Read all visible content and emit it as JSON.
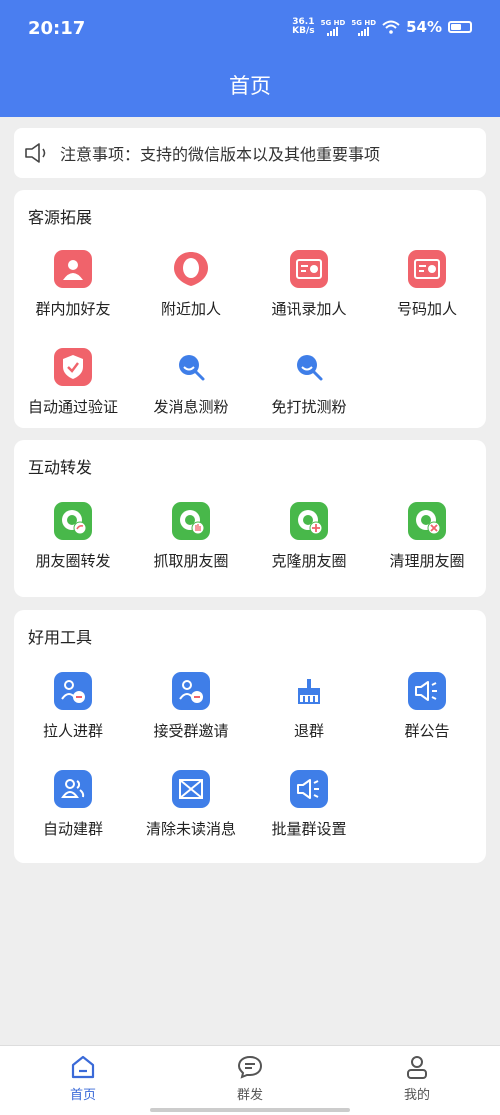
{
  "status_bar": {
    "time": "20:17",
    "net_speed_top": "36.1",
    "net_speed_unit": "KB/s",
    "sim1_label": "5G HD",
    "sim2_label": "5G HD",
    "battery": "54%"
  },
  "header": {
    "title": "首页"
  },
  "notice": {
    "icon": "speaker-icon",
    "text": "注意事项：支持的微信版本以及其他重要事项"
  },
  "sections": [
    {
      "title": "客源拓展",
      "items": [
        {
          "label": "群内加好友",
          "icon": "group-add-friend-icon"
        },
        {
          "label": "附近加人",
          "icon": "location-pin-icon"
        },
        {
          "label": "通讯录加人",
          "icon": "contacts-card-icon"
        },
        {
          "label": "号码加人",
          "icon": "number-card-icon"
        },
        {
          "label": "自动通过验证",
          "icon": "shield-check-icon"
        },
        {
          "label": "发消息测粉",
          "icon": "search-icon"
        },
        {
          "label": "免打扰测粉",
          "icon": "search-icon"
        }
      ]
    },
    {
      "title": "互动转发",
      "items": [
        {
          "label": "朋友圈转发",
          "icon": "moments-share-icon"
        },
        {
          "label": "抓取朋友圈",
          "icon": "moments-grab-icon"
        },
        {
          "label": "克隆朋友圈",
          "icon": "moments-clone-icon"
        },
        {
          "label": "清理朋友圈",
          "icon": "moments-clean-icon"
        }
      ]
    },
    {
      "title": "好用工具",
      "items": [
        {
          "label": "拉人进群",
          "icon": "pull-into-group-icon"
        },
        {
          "label": "接受群邀请",
          "icon": "accept-invite-icon"
        },
        {
          "label": "退群",
          "icon": "broom-icon"
        },
        {
          "label": "群公告",
          "icon": "announcement-icon"
        },
        {
          "label": "自动建群",
          "icon": "create-group-icon"
        },
        {
          "label": "清除未读消息",
          "icon": "envelope-clear-icon"
        },
        {
          "label": "批量群设置",
          "icon": "batch-settings-icon"
        }
      ]
    }
  ],
  "tabbar": {
    "items": [
      {
        "label": "首页",
        "icon": "home-icon",
        "active": true
      },
      {
        "label": "群发",
        "icon": "chat-bubble-icon",
        "active": false
      },
      {
        "label": "我的",
        "icon": "user-icon",
        "active": false
      }
    ]
  },
  "colors": {
    "header_bg": "#4a7ef0",
    "red_icon": "#f0636b",
    "blue_icon": "#3f7ee8",
    "green_icon": "#48b84a",
    "tab_active": "#3a6ad8"
  }
}
